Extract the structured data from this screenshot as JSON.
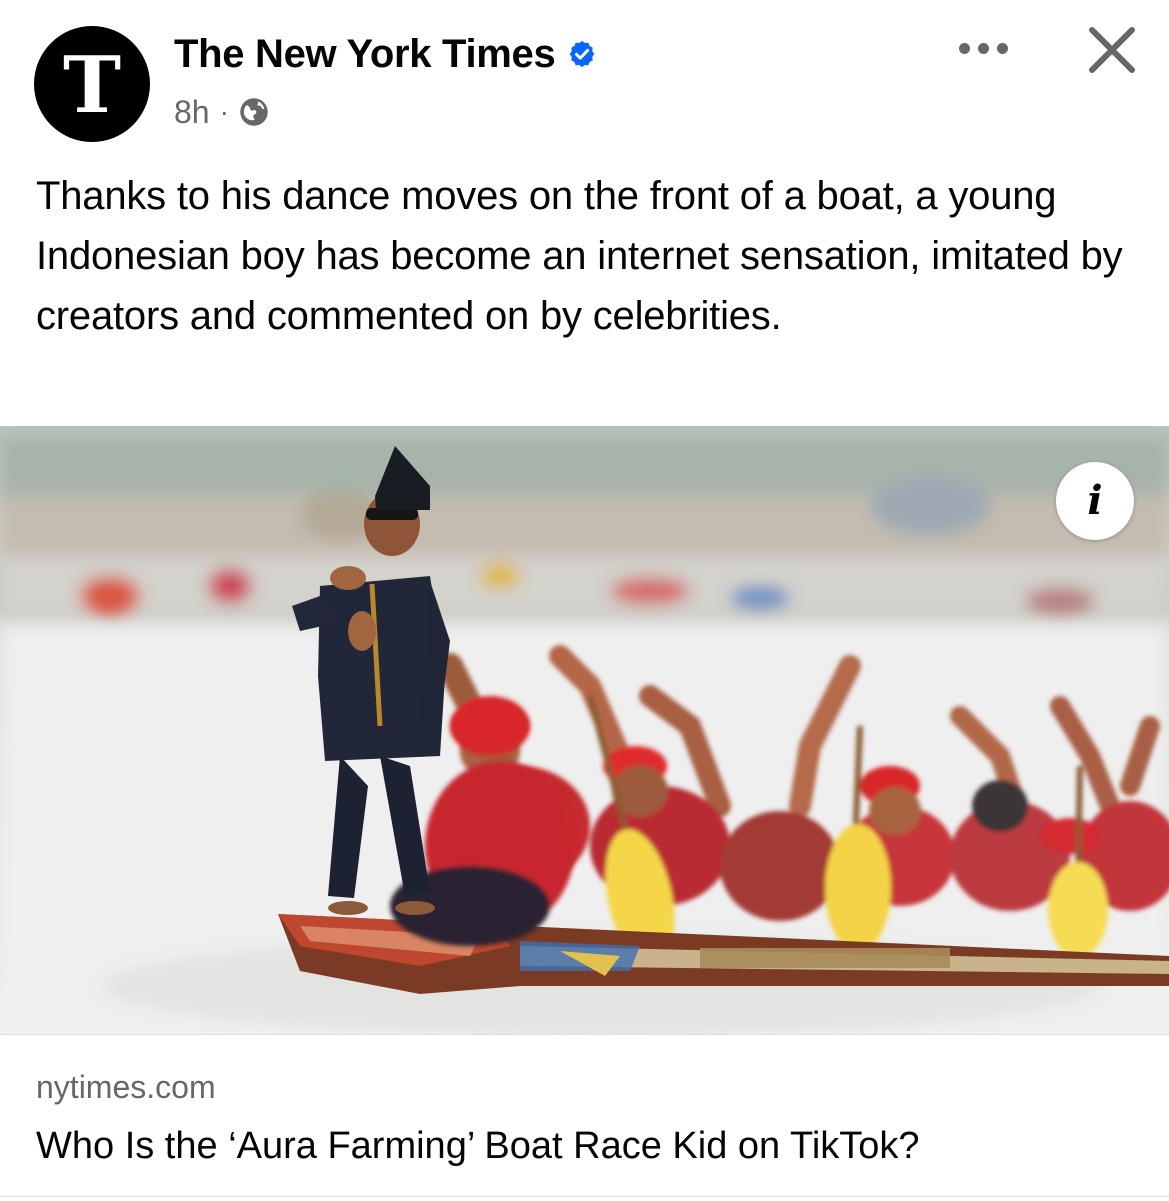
{
  "post": {
    "page_name": "The New York Times",
    "avatar_glyph": "T",
    "time": "8h",
    "meta_separator": "·",
    "audience_icon": "globe-icon",
    "verified_icon": "verified-badge-icon",
    "caption": "Thanks to his dance moves on the front of a boat, a young Indonesian boy has become an internet sensation, imitated by creators and commented on by celebrities.",
    "info_glyph": "i"
  },
  "link_preview": {
    "domain": "nytimes.com",
    "title": "Who Is the ‘Aura Farming’ Boat Race Kid on TikTok?"
  },
  "colors": {
    "verified_blue": "#0866ff",
    "secondary_text": "#65676b",
    "primary_text": "#050505"
  }
}
